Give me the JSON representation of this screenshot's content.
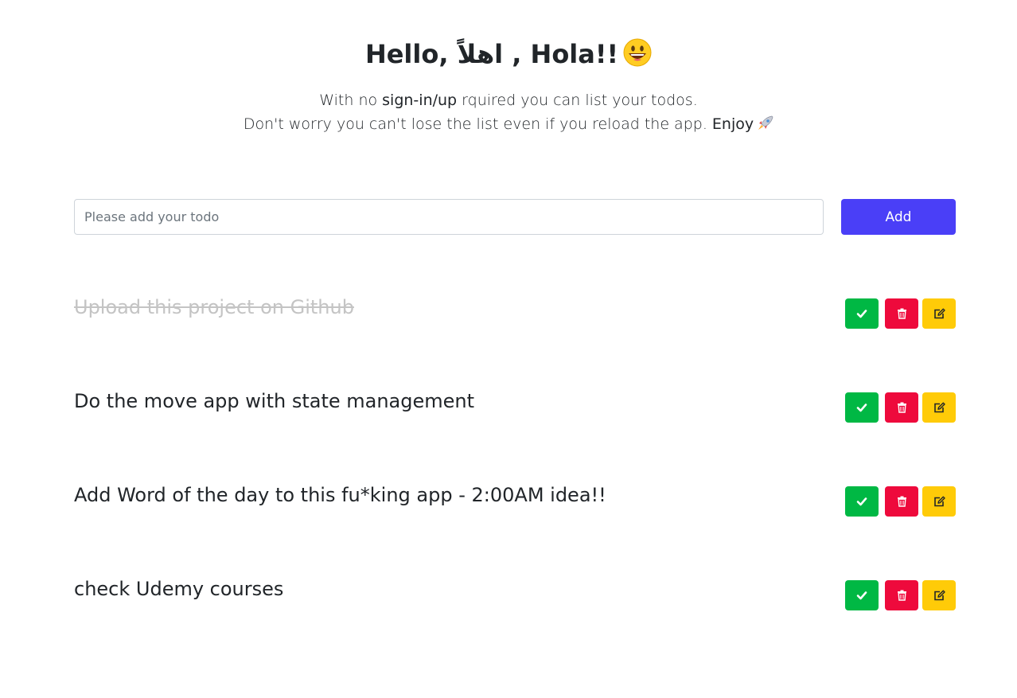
{
  "header": {
    "title": "Hello, اهلاً , Hola!!",
    "title_emoji": "smiley-icon",
    "line1_pre": "With no ",
    "line1_bold": "sign-in/up",
    "line1_post": " rquired you can list your todos.",
    "line2_pre": "Don't worry you can't lose the list even if you reload the app. ",
    "line2_bold": "Enjoy",
    "line2_emoji": "rocket-icon"
  },
  "form": {
    "input_placeholder": "Please add your todo",
    "input_value": "",
    "add_label": "Add"
  },
  "todos": [
    {
      "text": "Upload this project on Github",
      "completed": true
    },
    {
      "text": "Do the move app with state management",
      "completed": false
    },
    {
      "text": "Add Word of the day to this fu*king app - 2:00AM idea!!",
      "completed": false
    },
    {
      "text": "check Udemy courses",
      "completed": false
    }
  ],
  "icons": {
    "done": "check-icon",
    "delete": "trash-icon",
    "edit": "edit-icon"
  },
  "colors": {
    "accent": "#4a3ff7",
    "done_button": "#00b844",
    "delete_button": "#ee0a3c",
    "edit_button": "#ffcb08",
    "completed_text": "#c4c4c4"
  }
}
